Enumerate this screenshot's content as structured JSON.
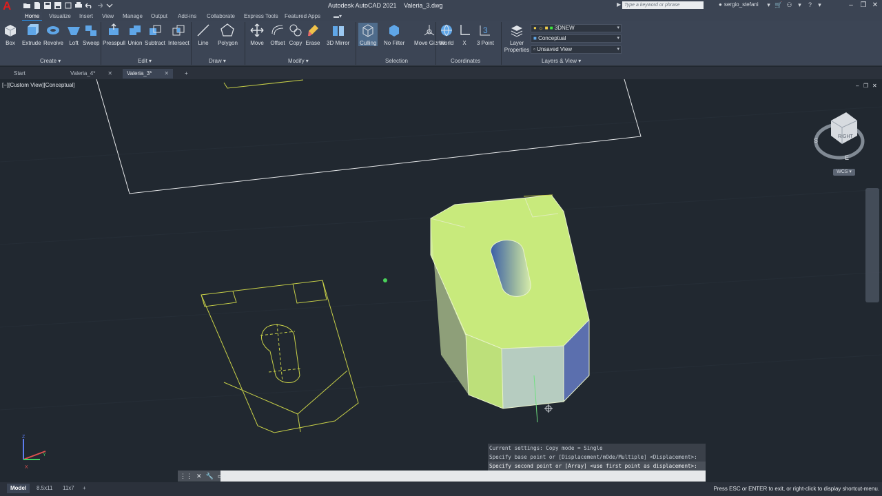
{
  "app": {
    "title": "Autodesk AutoCAD 2021",
    "filename": "Valeria_3.dwg",
    "logo": "A",
    "search_placeholder": "Type a keyword or phrase",
    "username": "sergio_stefani"
  },
  "ribbon_tabs": [
    "Home",
    "Visualize",
    "Insert",
    "View",
    "Manage",
    "Output",
    "Add-ins",
    "Collaborate",
    "Express Tools",
    "Featured Apps"
  ],
  "ribbon": {
    "create": {
      "label": "Create",
      "tools": [
        "Box",
        "Extrude",
        "Revolve",
        "Loft",
        "Sweep"
      ]
    },
    "edit": {
      "label": "Edit",
      "tools": [
        "Presspull",
        "Union",
        "Subtract",
        "Intersect"
      ]
    },
    "draw": {
      "label": "Draw",
      "tools": [
        "Line",
        "Polygon"
      ]
    },
    "modify": {
      "label": "Modify",
      "tools": [
        "Move",
        "Offset",
        "Copy",
        "Erase",
        "3D Mirror"
      ]
    },
    "selection": {
      "label": "Selection",
      "tools": [
        "Culling",
        "No Filter",
        "Move Gizmo"
      ]
    },
    "coordinates": {
      "label": "Coordinates",
      "tools": [
        "World",
        "X",
        "3 Point"
      ]
    },
    "layers_view": {
      "label": "Layers & View",
      "layer_properties": "Layer Properties",
      "layer_value": "3DNEW",
      "visual_style": "Conceptual",
      "view": "Unsaved View"
    }
  },
  "doc_tabs": [
    "Start",
    "Valeria_4*",
    "Valeria_3*"
  ],
  "viewport": {
    "label": "[−][Custom View][Conceptual]",
    "viewcube_face": "RIGHT",
    "compass": [
      "S",
      "E"
    ],
    "ucs_label": "WCS"
  },
  "command": {
    "history": [
      "Current settings:  Copy mode = Single",
      "Specify base point or [Displacement/mOde/Multiple] <Displacement>:",
      "Specify second point or [Array] <use first point as displacement>:"
    ]
  },
  "status": {
    "tabs": [
      "Model",
      "8.5x11",
      "11x7"
    ],
    "message": "Press ESC or ENTER to exit, or right-click to display shortcut-menu."
  },
  "colors": {
    "solid_face": "#c8ea7c",
    "solid_side": "#5b6fae",
    "wireframe": "#c9d148",
    "background": "#212830"
  }
}
